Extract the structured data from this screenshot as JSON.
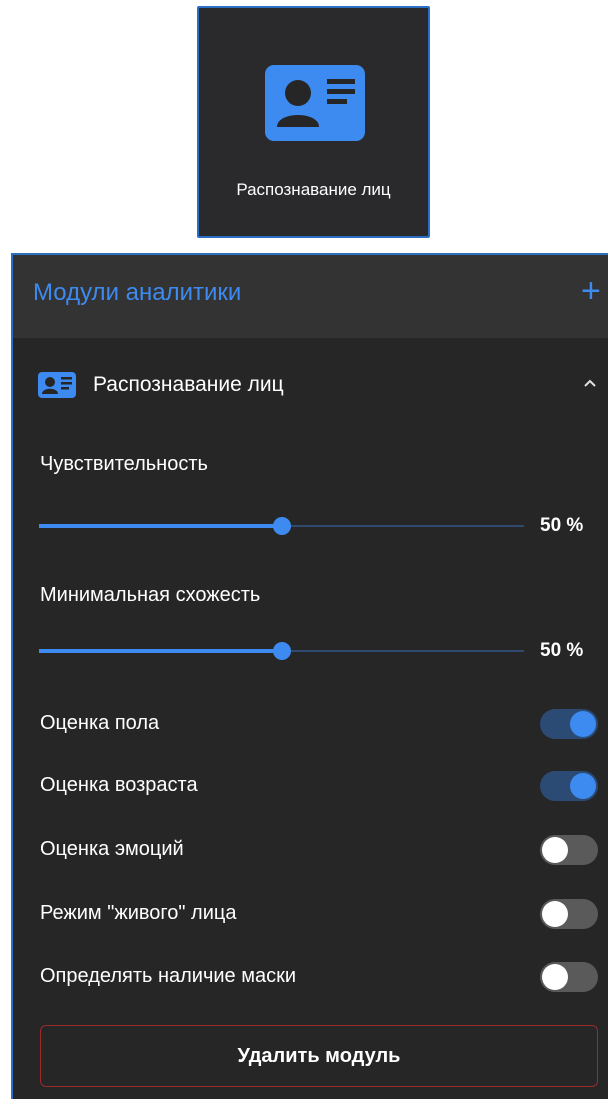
{
  "tile": {
    "label": "Распознавание лиц",
    "icon": "id-card-icon"
  },
  "panel": {
    "title": "Модули аналитики",
    "add_icon": "+",
    "module": {
      "title": "Распознавание лиц",
      "icon": "id-card-icon",
      "chevron": "^"
    },
    "sliders": [
      {
        "label": "Чувствительность",
        "value": 50,
        "value_text": "50 %"
      },
      {
        "label": "Минимальная схожесть",
        "value": 50,
        "value_text": "50 %"
      }
    ],
    "toggles": [
      {
        "label": "Оценка пола",
        "on": true
      },
      {
        "label": "Оценка возраста",
        "on": true
      },
      {
        "label": "Оценка эмоций",
        "on": false
      },
      {
        "label": "Режим \"живого\" лица",
        "on": false
      },
      {
        "label": "Определять наличие маски",
        "on": false
      }
    ],
    "delete_button": "Удалить модуль"
  },
  "colors": {
    "accent": "#3d8bf0",
    "panel_bg": "#262626",
    "header_bg": "#333334",
    "danger_border": "#9a2b2b"
  }
}
